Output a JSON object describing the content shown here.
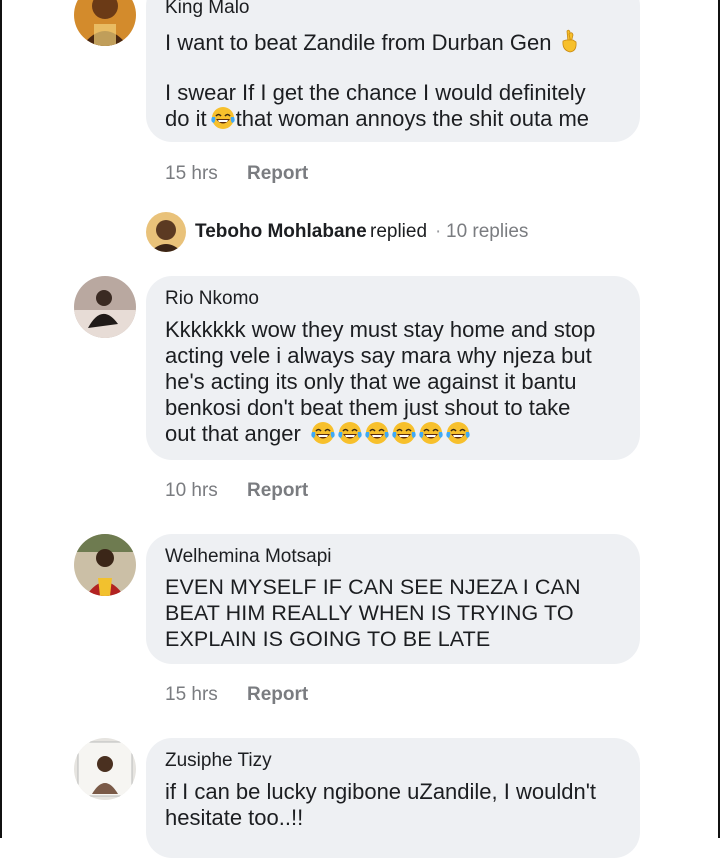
{
  "comments": [
    {
      "author": "King Malo",
      "lines": [
        "I want to beat Zandile from Durban Gen",
        "",
        "I swear If I get the chance I would definitely",
        "do it",
        "that woman annoys the shit outa me"
      ],
      "time": "15 hrs",
      "report": "Report",
      "avatar_icon": "profile-photo-icon",
      "emoji": [
        "fingers-crossed-icon",
        "tears-of-joy-icon"
      ]
    },
    {
      "author": "Rio Nkomo",
      "lines": [
        "Kkkkkkk wow they must stay home and stop",
        "acting vele i always say mara why njeza but",
        "he's acting its only that we against it bantu",
        "benkosi don't beat them just shout to take",
        "out that anger"
      ],
      "time": "10 hrs",
      "report": "Report",
      "avatar_icon": "profile-photo-icon",
      "emoji_count": 6
    },
    {
      "author": "Welhemina Motsapi",
      "lines": [
        "EVEN MYSELF IF CAN SEE NJEZA I CAN",
        "BEAT HIM REALLY WHEN IS TRYING TO",
        "EXPLAIN IS GOING TO BE LATE"
      ],
      "time": "15 hrs",
      "report": "Report",
      "avatar_icon": "profile-photo-icon"
    },
    {
      "author": "Zusiphe Tizy",
      "lines": [
        "if I can be lucky ngibone uZandile, I wouldn't",
        "hesitate too..!!"
      ],
      "avatar_icon": "profile-photo-icon"
    }
  ],
  "reply_summary": {
    "name": "Teboho Mohlabane",
    "verb": "replied",
    "separator": "·",
    "count": "10 replies"
  },
  "colors": {
    "bubble": "#eef0f3",
    "meta_text": "#7a7c80",
    "body_text": "#1c1e21",
    "emoji_face": "#f7c02c",
    "emoji_tear": "#3fa9f5"
  }
}
